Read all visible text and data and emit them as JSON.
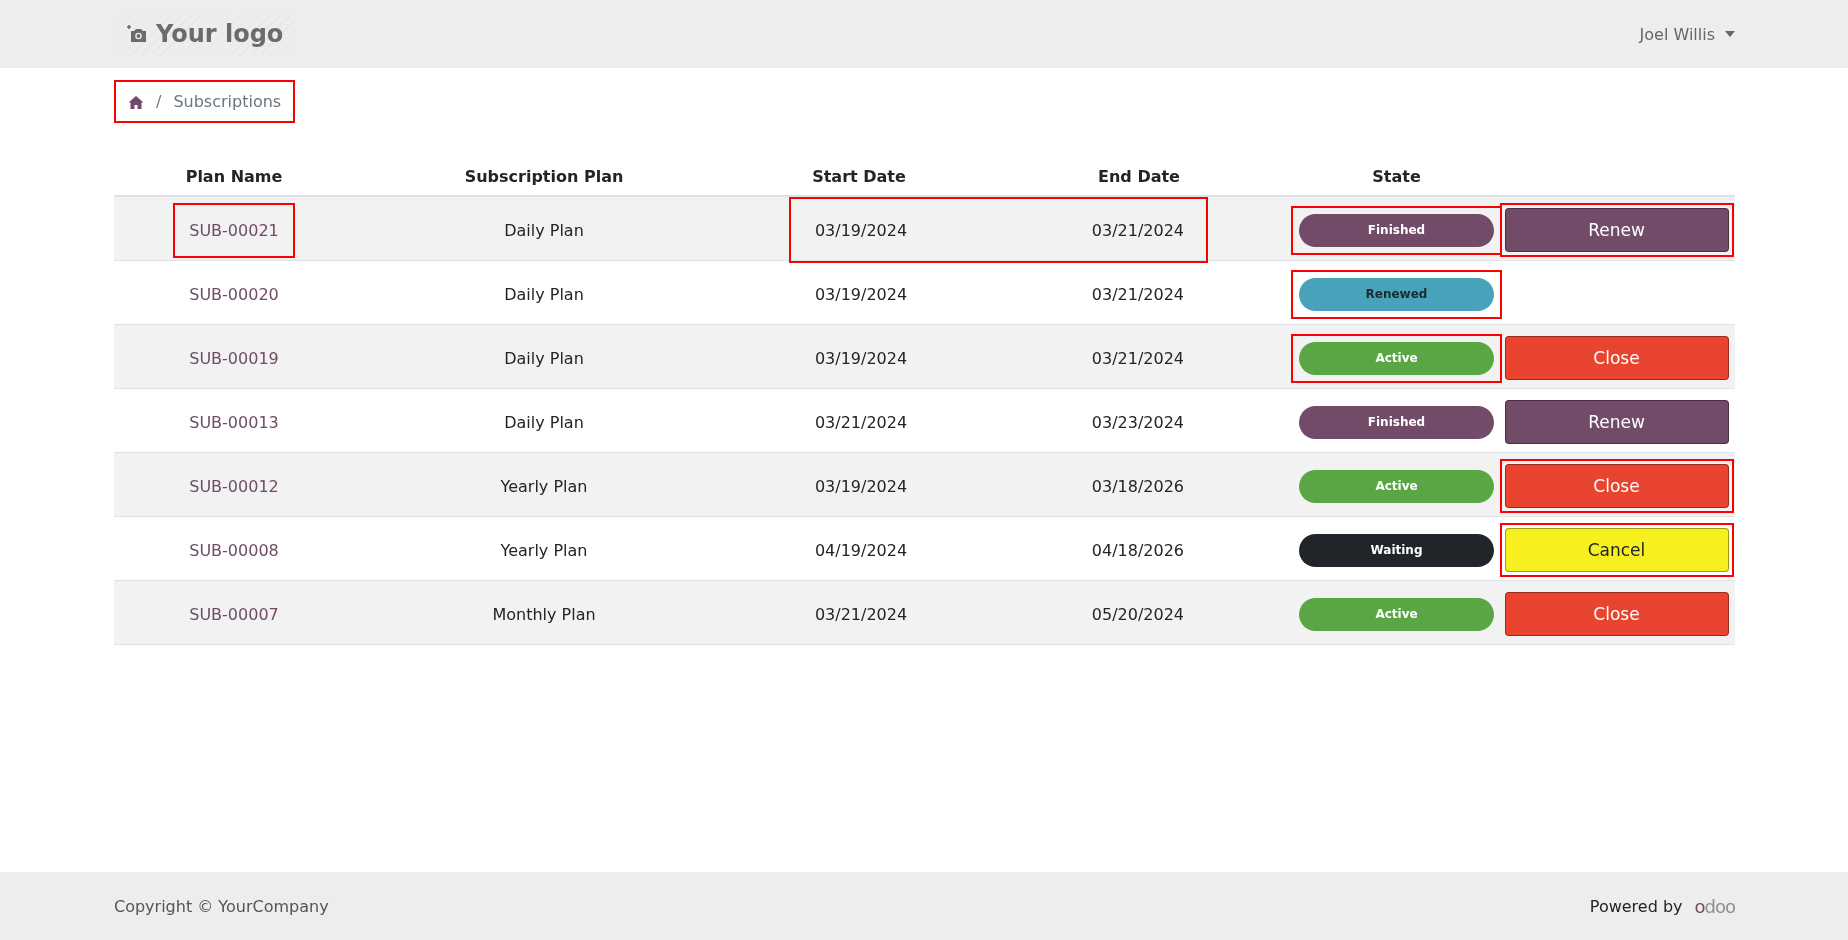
{
  "header": {
    "logo": "Your logo",
    "user": "Joel Willis"
  },
  "breadcrumb": {
    "separator": "/",
    "current": "Subscriptions",
    "highlighted": true
  },
  "table": {
    "columns": [
      "Plan Name",
      "Subscription Plan",
      "Start Date",
      "End Date",
      "State"
    ],
    "rows": [
      {
        "name": "SUB-00021",
        "plan": "Daily Plan",
        "start": "03/19/2024",
        "end": "03/21/2024",
        "state": {
          "kind": "finished",
          "label": "Finished"
        },
        "action": {
          "kind": "renew",
          "label": "Renew"
        },
        "name_highlighted": true,
        "dates_highlighted": true,
        "state_highlighted": true,
        "action_highlighted": true
      },
      {
        "name": "SUB-00020",
        "plan": "Daily Plan",
        "start": "03/19/2024",
        "end": "03/21/2024",
        "state": {
          "kind": "renewed",
          "label": "Renewed"
        },
        "name_highlighted": false,
        "dates_highlighted": false,
        "state_highlighted": true
      },
      {
        "name": "SUB-00019",
        "plan": "Daily Plan",
        "start": "03/19/2024",
        "end": "03/21/2024",
        "state": {
          "kind": "active",
          "label": "Active"
        },
        "action": {
          "kind": "close",
          "label": "Close"
        },
        "name_highlighted": false,
        "dates_highlighted": false,
        "state_highlighted": true,
        "action_highlighted": false
      },
      {
        "name": "SUB-00013",
        "plan": "Daily Plan",
        "start": "03/21/2024",
        "end": "03/23/2024",
        "state": {
          "kind": "finished",
          "label": "Finished"
        },
        "action": {
          "kind": "renew",
          "label": "Renew"
        },
        "name_highlighted": false,
        "dates_highlighted": false,
        "state_highlighted": false,
        "action_highlighted": false
      },
      {
        "name": "SUB-00012",
        "plan": "Yearly Plan",
        "start": "03/19/2024",
        "end": "03/18/2026",
        "state": {
          "kind": "active",
          "label": "Active"
        },
        "action": {
          "kind": "close",
          "label": "Close"
        },
        "name_highlighted": false,
        "dates_highlighted": false,
        "state_highlighted": false,
        "action_highlighted": true
      },
      {
        "name": "SUB-00008",
        "plan": "Yearly Plan",
        "start": "04/19/2024",
        "end": "04/18/2026",
        "state": {
          "kind": "waiting",
          "label": "Waiting"
        },
        "action": {
          "kind": "cancel",
          "label": "Cancel"
        },
        "name_highlighted": false,
        "dates_highlighted": false,
        "state_highlighted": false,
        "action_highlighted": true
      },
      {
        "name": "SUB-00007",
        "plan": "Monthly Plan",
        "start": "03/21/2024",
        "end": "05/20/2024",
        "state": {
          "kind": "active",
          "label": "Active"
        },
        "action": {
          "kind": "close",
          "label": "Close"
        },
        "name_highlighted": false,
        "dates_highlighted": false,
        "state_highlighted": false,
        "action_highlighted": false
      }
    ]
  },
  "footer": {
    "copyright": "Copyright © YourCompany",
    "powered_by": "Powered by",
    "brand": "odoo"
  }
}
